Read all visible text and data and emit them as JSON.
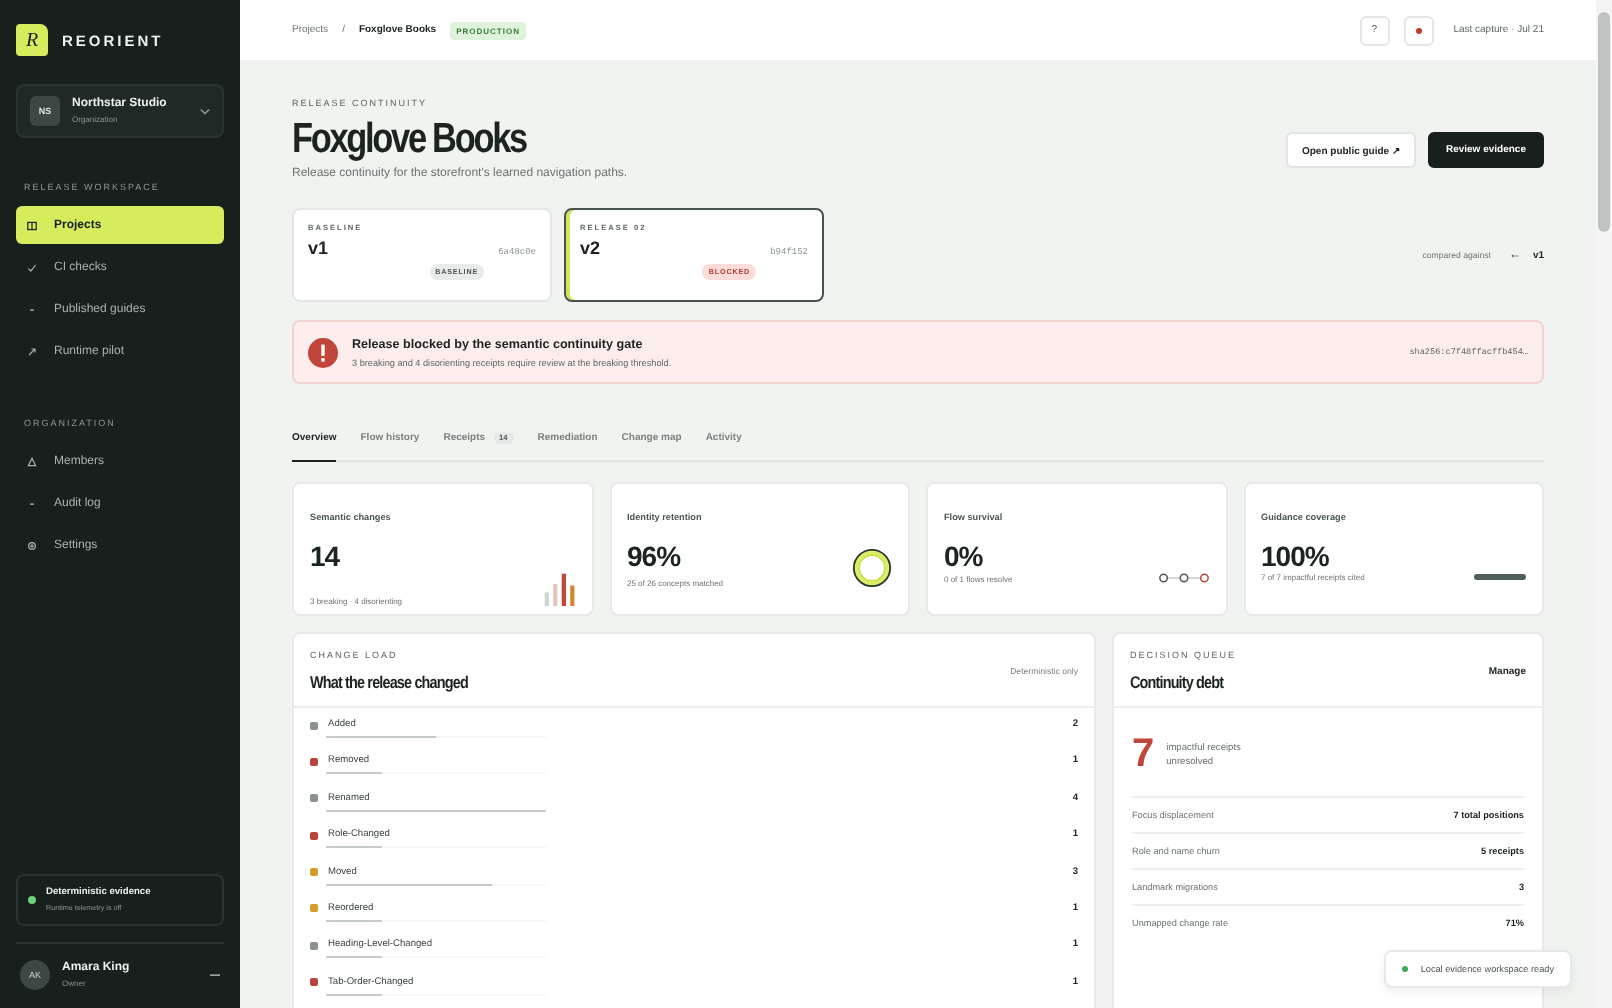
{
  "sidebar": {
    "brand": {
      "mark": "R",
      "name": "REORIENT"
    },
    "org": {
      "initials": "NS",
      "name": "Northstar Studio",
      "role": "Organization"
    },
    "sections": [
      {
        "title": "RELEASE WORKSPACE",
        "items": [
          {
            "label": "Projects",
            "kind": "grid",
            "selected": true
          },
          {
            "label": "CI checks",
            "kind": "check",
            "selected": false
          },
          {
            "label": "Published guides",
            "kind": "dot",
            "selected": false
          },
          {
            "label": "Runtime pilot",
            "kind": "arrow",
            "selected": false
          }
        ]
      },
      {
        "title": "ORGANIZATION",
        "items": [
          {
            "label": "Members",
            "kind": "person",
            "selected": false
          },
          {
            "label": "Audit log",
            "kind": "dot",
            "selected": false
          },
          {
            "label": "Settings",
            "kind": "gear",
            "selected": false
          }
        ]
      }
    ],
    "evidence": {
      "title": "Deterministic evidence",
      "subtitle": "Runtime telemetry is off"
    },
    "user": {
      "initials": "AK",
      "name": "Amara King",
      "role": "Owner"
    }
  },
  "topbar": {
    "breadcrumb": [
      "Projects",
      "Foxglove Books"
    ],
    "separator": "/",
    "env_badge": "PRODUCTION",
    "help": "?",
    "last_capture": "Last capture · Jul 21"
  },
  "header": {
    "eyebrow": "RELEASE CONTINUITY",
    "title": "Foxglove Books",
    "subtitle": "Release continuity for the storefront's learned navigation paths.",
    "buttons": [
      {
        "label": "Open public guide ↗",
        "kind": "secondary"
      },
      {
        "label": "Review evidence",
        "kind": "primary"
      }
    ]
  },
  "versions": [
    {
      "eyebrow": "BASELINE",
      "version": "v1",
      "hash": "6a48c0e",
      "badge": "BASELINE",
      "kind": "baseline",
      "selected": false
    },
    {
      "eyebrow": "RELEASE 02",
      "version": "v2",
      "hash": "b94f152",
      "badge": "BLOCKED",
      "kind": "release",
      "selected": true
    }
  ],
  "compare": {
    "label": "compared against",
    "arrow": "←",
    "version": "v1"
  },
  "gate": {
    "title": "Release blocked by the semantic continuity gate",
    "detail": "3 breaking and 4 disorienting receipts require review at the breaking threshold.",
    "digest": "sha256:c7f48ffacffb454…"
  },
  "tabs": [
    {
      "label": "Overview",
      "selected": true
    },
    {
      "label": "Flow history",
      "selected": false
    },
    {
      "label": "Receipts",
      "count": "14",
      "selected": false
    },
    {
      "label": "Remediation",
      "selected": false
    },
    {
      "label": "Change map",
      "selected": false
    },
    {
      "label": "Activity",
      "selected": false
    }
  ],
  "metrics": [
    {
      "label": "Semantic changes",
      "value": "14",
      "note": "3 breaking · 4 disorienting",
      "kind": "bars"
    },
    {
      "label": "Identity retention",
      "value": "96%",
      "note": "25 of 26 concepts matched",
      "kind": "ring"
    },
    {
      "label": "Flow survival",
      "value": "0%",
      "note": "0 of 1 flows resolve",
      "kind": "path"
    },
    {
      "label": "Guidance coverage",
      "value": "100%",
      "note": "7 of 7 impactful receipts cited",
      "kind": "line"
    }
  ],
  "change_load": {
    "eyebrow": "CHANGE LOAD",
    "title": "What the release changed",
    "note": "Deterministic only",
    "rows": [
      {
        "label": "Added",
        "count": "2",
        "level": 0.5,
        "color": "#8a918d"
      },
      {
        "label": "Removed",
        "count": "1",
        "level": 0.25,
        "color": "#b8453a"
      },
      {
        "label": "Renamed",
        "count": "4",
        "level": 1,
        "color": "#8a918d"
      },
      {
        "label": "Role-Changed",
        "count": "1",
        "level": 0.25,
        "color": "#b8453a"
      },
      {
        "label": "Moved",
        "count": "3",
        "level": 0.75,
        "color": "#d49a2a"
      },
      {
        "label": "Reordered",
        "count": "1",
        "level": 0.25,
        "color": "#d49a2a"
      },
      {
        "label": "Heading-Level-Changed",
        "count": "1",
        "level": 0.25,
        "color": "#8a918d"
      },
      {
        "label": "Tab-Order-Changed",
        "count": "1",
        "level": 0.25,
        "color": "#b8453a"
      }
    ]
  },
  "decision_queue": {
    "eyebrow": "DECISION QUEUE",
    "title": "Continuity debt",
    "action": "Manage",
    "count": "7",
    "count_label": "impactful receipts unresolved",
    "rows": [
      {
        "label": "Focus displacement",
        "value": "7 total positions"
      },
      {
        "label": "Role and name churn",
        "value": "5 receipts"
      },
      {
        "label": "Landmark migrations",
        "value": "3"
      },
      {
        "label": "Unmapped change rate",
        "value": "71%"
      }
    ]
  },
  "toast": {
    "text": "Local evidence workspace ready"
  }
}
